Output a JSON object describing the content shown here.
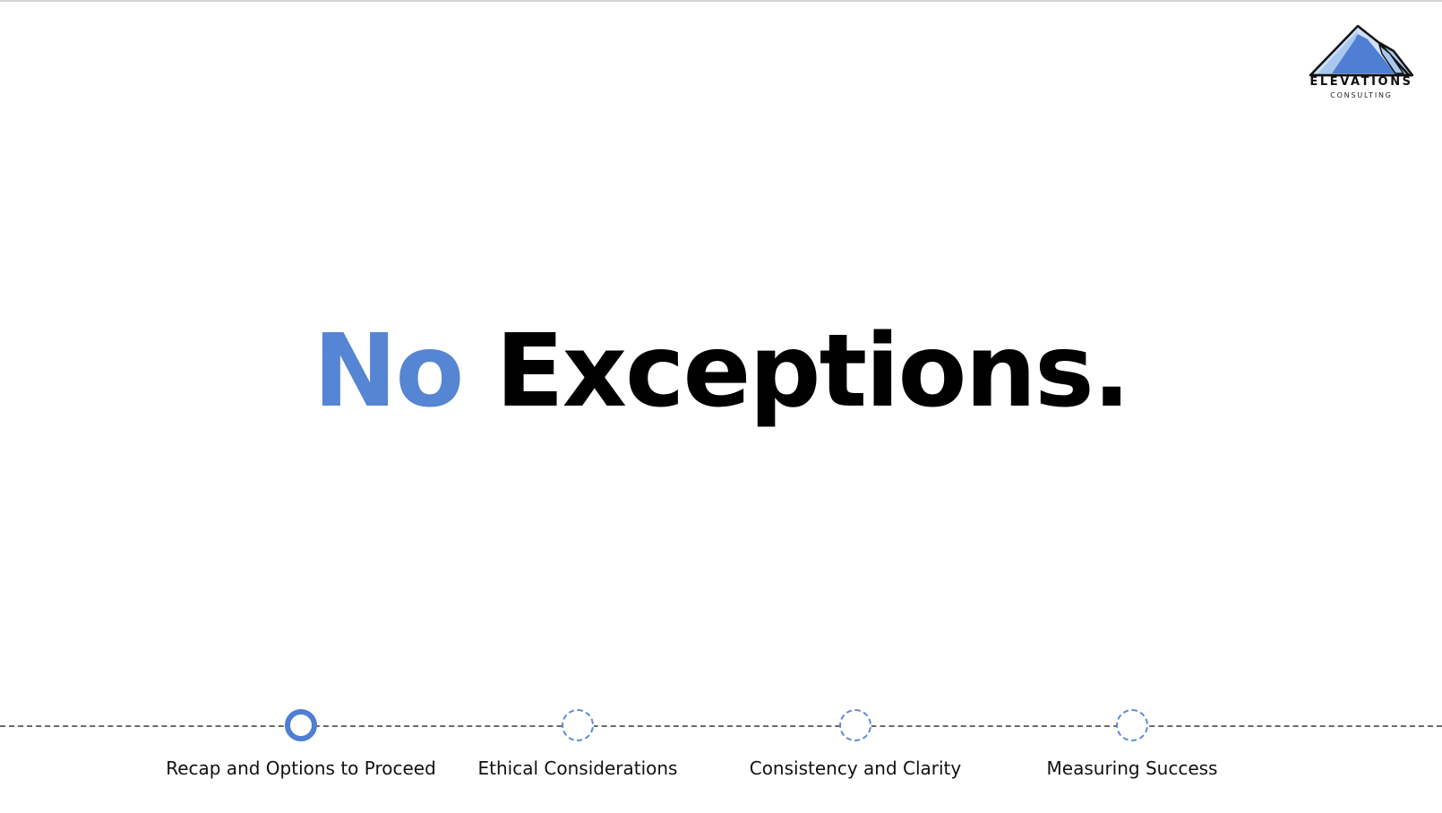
{
  "logo": {
    "wordmark": "ELEVATIONS",
    "subtitle": "CONSULTING",
    "icon": "mountain-icon",
    "colors": {
      "light": "#a9c8f0",
      "mid": "#4f7ed3",
      "outline": "#111111"
    }
  },
  "headline": {
    "accent": "No",
    "main": "Exceptions."
  },
  "colors": {
    "accent": "#5585d3",
    "text": "#000000",
    "timeline_line": "#6a6a6a"
  },
  "timeline": {
    "steps": [
      {
        "label": "Recap and Options to Proceed",
        "state": "active"
      },
      {
        "label": "Ethical Considerations",
        "state": "pending"
      },
      {
        "label": "Consistency and Clarity",
        "state": "pending"
      },
      {
        "label": "Measuring Success",
        "state": "pending"
      }
    ]
  }
}
